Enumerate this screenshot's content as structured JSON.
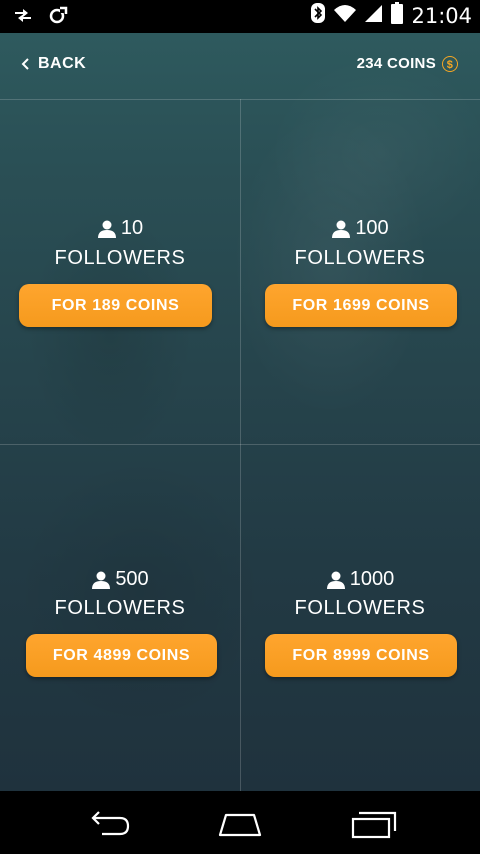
{
  "status_bar": {
    "time": "21:04",
    "icons": [
      "transfer-icon",
      "sync-icon",
      "bluetooth-icon",
      "wifi-icon",
      "signal-icon",
      "battery-icon"
    ]
  },
  "header": {
    "back_label": "BACK",
    "coins_label": "234 COINS",
    "coin_symbol": "$"
  },
  "offers": [
    {
      "count": "10",
      "unit": "FOLLOWERS",
      "button": "FOR 189 COINS"
    },
    {
      "count": "100",
      "unit": "FOLLOWERS",
      "button": "FOR 1699 COINS"
    },
    {
      "count": "500",
      "unit": "FOLLOWERS",
      "button": "FOR 4899 COINS"
    },
    {
      "count": "1000",
      "unit": "FOLLOWERS",
      "button": "FOR 8999 COINS"
    }
  ],
  "colors": {
    "accent": "#f59a1d",
    "background_top": "#2e5a5e",
    "background_bottom": "#1f323d"
  }
}
